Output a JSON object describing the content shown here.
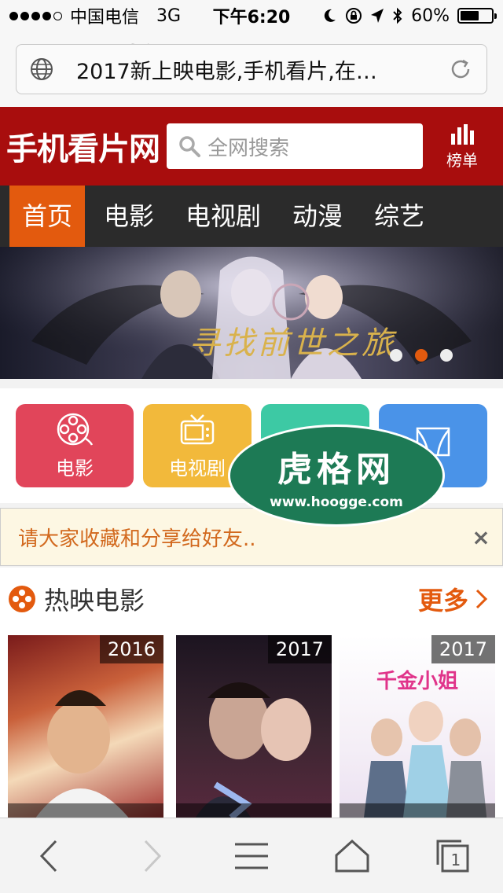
{
  "status_bar": {
    "carrier": "中国电信",
    "network": "3G",
    "time": "下午6:20",
    "battery_percent": "60%",
    "battery_level": 0.6
  },
  "browser": {
    "url_title": "2017新上映电影,手机看片,在…",
    "watermark": "BOSS 资源"
  },
  "site": {
    "logo": "手机看片网",
    "search_placeholder": "全网搜索",
    "rank_label": "榜单",
    "brand_color": "#a80d0d",
    "accent_color": "#e35a0e"
  },
  "nav": {
    "items": [
      "首页",
      "电影",
      "电视剧",
      "动漫",
      "综艺"
    ],
    "active_index": 0
  },
  "banner": {
    "title_art": "寻找前世之旅",
    "slides": 3,
    "active_slide": 1
  },
  "categories": [
    {
      "label": "电影",
      "icon": "film-reel-icon",
      "color": "#e1455a"
    },
    {
      "label": "电视剧",
      "icon": "tv-icon",
      "color": "#f2b93b"
    },
    {
      "label": "",
      "icon": "heart-icon",
      "color": "#3dc9a4"
    },
    {
      "label": "",
      "icon": "theater-icon",
      "color": "#4a93e8"
    }
  ],
  "watermark_oval": {
    "big": "虎格网",
    "small": "www.hoogge.com"
  },
  "notice": {
    "text": "请大家收藏和分享给好友..",
    "close": "×"
  },
  "section": {
    "title": "热映电影",
    "more": "更多"
  },
  "movies": [
    {
      "year": "2016"
    },
    {
      "year": "2017"
    },
    {
      "year": "2017",
      "poster_text": "千金小姐"
    }
  ],
  "toolbar": {
    "tabs_count": "1"
  }
}
